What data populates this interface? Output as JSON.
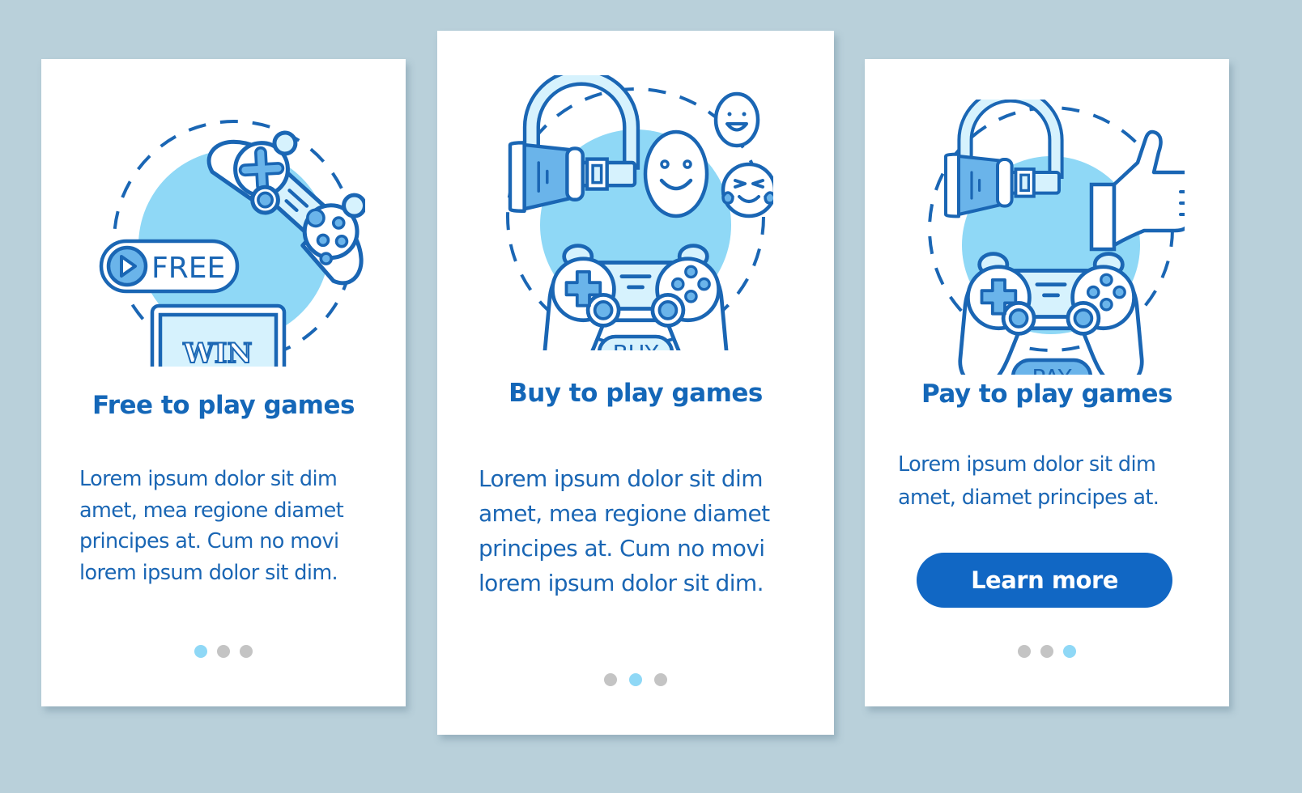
{
  "colors": {
    "background": "#b9d0da",
    "card": "#ffffff",
    "accent": "#1467b8",
    "button": "#1167c4",
    "illustration_fill": "#8fd8f6",
    "illustration_stroke": "#1a66b4",
    "dot_active": "#8fd8f6",
    "dot_inactive": "#c4c4c4"
  },
  "screens": [
    {
      "illustration": {
        "icons": [
          "gamepad-icon",
          "play-icon",
          "laptop-icon"
        ],
        "badge_label": "FREE",
        "screen_label": "WIN"
      },
      "title": "Free to play games",
      "body_lines": [
        "Lorem ipsum dolor sit dim",
        "amet, mea regione diamet",
        "principes at. Cum no movi",
        "lorem ipsum dolor sit dim."
      ],
      "pagination": {
        "total": 3,
        "active": 1
      }
    },
    {
      "illustration": {
        "icons": [
          "vr-headset-icon",
          "smile-face-icon",
          "laughing-face-icon",
          "tears-of-joy-face-icon",
          "gamepad-icon"
        ],
        "badge_label": "BUY"
      },
      "title": "Buy to play games",
      "body_lines": [
        "Lorem ipsum dolor sit dim",
        "amet, mea regione diamet",
        "principes at. Cum no movi",
        "lorem ipsum dolor sit dim."
      ],
      "pagination": {
        "total": 3,
        "active": 2
      }
    },
    {
      "illustration": {
        "icons": [
          "vr-headset-icon",
          "thumbs-up-icon",
          "gamepad-icon"
        ],
        "badge_label": "PAY"
      },
      "title": "Pay to play games",
      "body_lines": [
        "Lorem ipsum dolor sit dim",
        "amet, diamet principes at."
      ],
      "button_label": "Learn more",
      "pagination": {
        "total": 3,
        "active": 3
      }
    }
  ]
}
